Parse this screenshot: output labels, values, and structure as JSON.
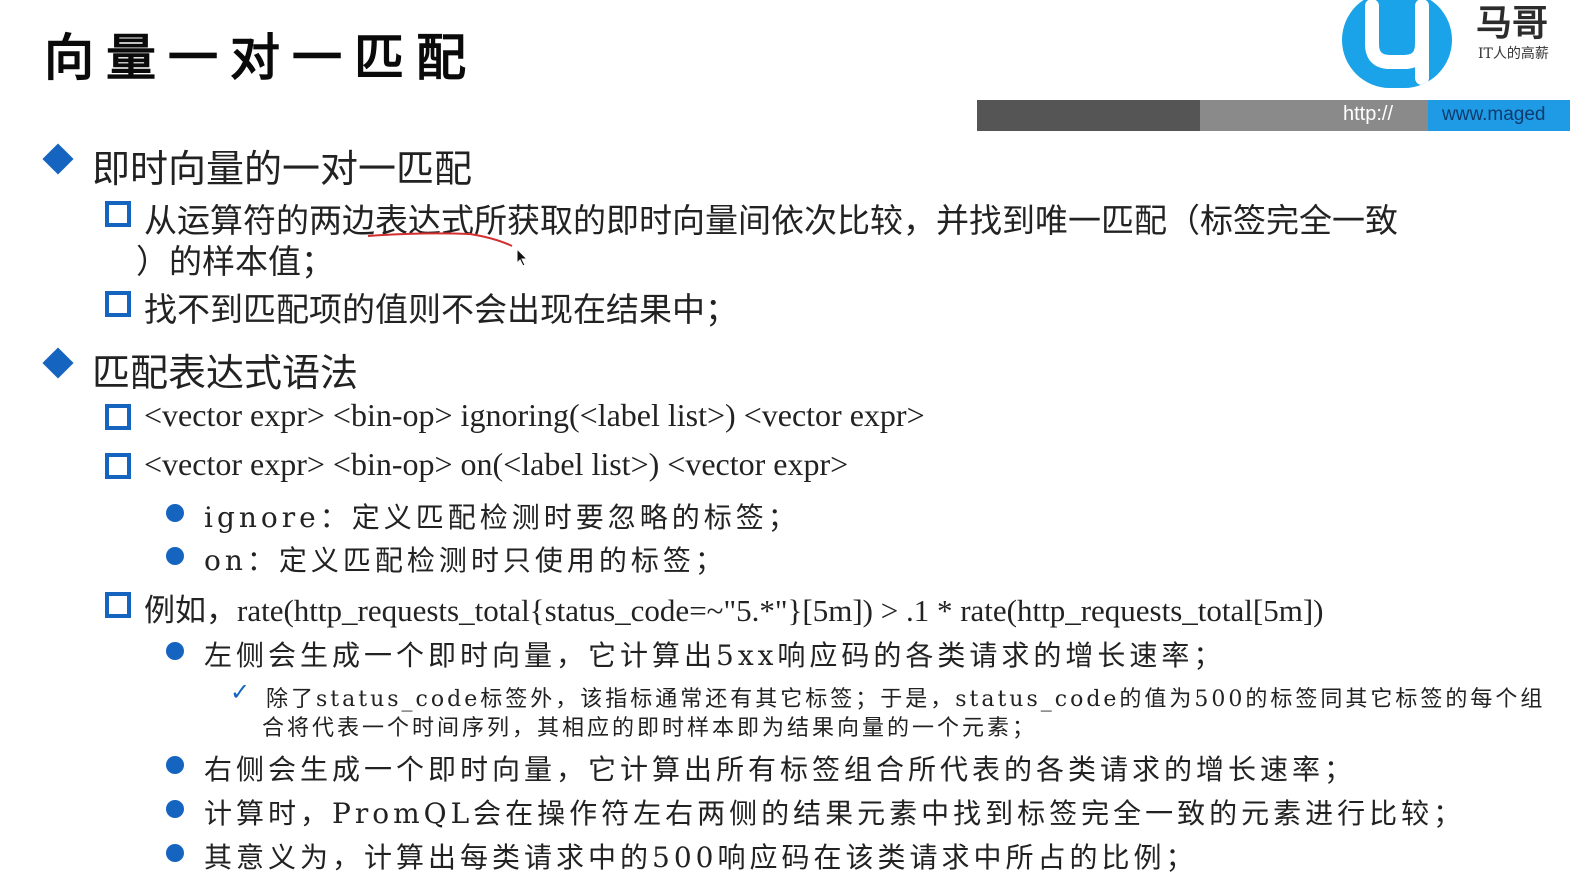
{
  "slide": {
    "title": "向量一对一匹配",
    "logo": {
      "brand_text": "马哥",
      "slogan": "IT人的高薪",
      "url_protocol": "http://",
      "url_host": "www.maged"
    },
    "section1": {
      "heading": "即时向量的一对一匹配",
      "item1_line1": "从运算符的两边表达式所获取的即时向量间依次比较，并找到唯一匹配（标签完全一致",
      "item1_line2": "）的样本值；",
      "item2": "找不到匹配项的值则不会出现在结果中；"
    },
    "section2": {
      "heading": "匹配表达式语法",
      "syntax1": "<vector expr> <bin-op> ignoring(<label list>) <vector expr>",
      "syntax2": "<vector expr> <bin-op> on(<label list>) <vector expr>",
      "ignore_desc": "ignore：定义匹配检测时要忽略的标签；",
      "on_desc": "on：定义匹配检测时只使用的标签；",
      "example": "例如，rate(http_requests_total{status_code=~\"5.*\"}[5m]) > .1 * rate(http_requests_total[5m])",
      "left_desc": "左侧会生成一个即时向量，它计算出5xx响应码的各类请求的增长速率；",
      "left_note_line1": "除了status_code标签外，该指标通常还有其它标签；于是，status_code的值为500的标签同其它标签的每个组",
      "left_note_line2": "合将代表一个时间序列，其相应的即时样本即为结果向量的一个元素；",
      "right_desc": "右侧会生成一个即时向量，它计算出所有标签组合所代表的各类请求的增长速率；",
      "compute_desc": "计算时，PromQL会在操作符左右两侧的结果元素中找到标签完全一致的元素进行比较；",
      "meaning_desc": "其意义为，计算出每类请求中的500响应码在该类请求中所占的比例；"
    },
    "colors": {
      "bullet_blue": "#1565c0",
      "logo_blue": "#1aa3e8",
      "annotation_red": "#d32f2f"
    }
  }
}
